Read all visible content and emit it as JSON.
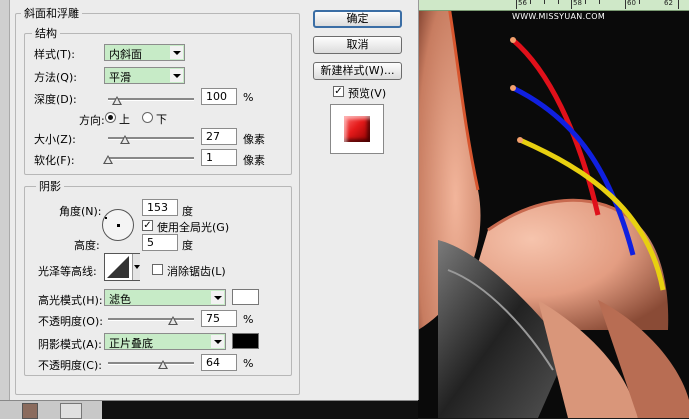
{
  "dialog": {
    "section_title": "斜面和浮雕",
    "structure": {
      "title": "结构",
      "style_label": "样式(T):",
      "style_value": "内斜面",
      "technique_label": "方法(Q):",
      "technique_value": "平滑",
      "depth_label": "深度(D):",
      "depth_value": "100",
      "depth_unit": "%",
      "depth_level": 0.1,
      "direction_label": "方向:",
      "direction_up": "上",
      "direction_down": "下",
      "size_label": "大小(Z):",
      "size_value": "27",
      "size_unit": "像素",
      "size_level": 0.2,
      "soften_label": "软化(F):",
      "soften_value": "1",
      "soften_unit": "像素",
      "soften_level": 0.0
    },
    "shading": {
      "title": "阴影",
      "angle_label": "角度(N):",
      "angle_value": "153",
      "angle_unit": "度",
      "global_light_label": "使用全局光(G)",
      "global_light_checked": true,
      "altitude_label": "高度:",
      "altitude_value": "5",
      "altitude_unit": "度",
      "gloss_contour_label": "光泽等高线:",
      "anti_aliased_label": "消除锯齿(L)",
      "anti_aliased_checked": false,
      "highlight_mode_label": "高光模式(H):",
      "highlight_mode_value": "滤色",
      "highlight_color": "#ffffff",
      "highlight_opacity_label": "不透明度(O):",
      "highlight_opacity_value": "75",
      "highlight_opacity_unit": "%",
      "highlight_opacity_level": 0.75,
      "shadow_mode_label": "阴影模式(A):",
      "shadow_mode_value": "正片叠底",
      "shadow_color": "#000000",
      "shadow_opacity_label": "不透明度(C):",
      "shadow_opacity_value": "64",
      "shadow_opacity_unit": "%",
      "shadow_opacity_level": 0.64
    },
    "buttons": {
      "ok": "确定",
      "cancel": "取消",
      "new_style": "新建样式(W)...",
      "preview_label": "预览(V)",
      "preview_checked": true
    }
  },
  "canvas": {
    "ruler_labels": [
      "56",
      "58",
      "60",
      "62"
    ],
    "watermark": "WWW.MISSYUAN.COM"
  },
  "colors": {
    "dialog_bg": "#ececec",
    "dropdown_bg": "#c7ebc7",
    "ruler_bg": "#cfe8c8",
    "wire_red": "#e0101a",
    "wire_blue": "#1020e0",
    "wire_yellow": "#e8d010",
    "skin": "#e8a58a"
  }
}
